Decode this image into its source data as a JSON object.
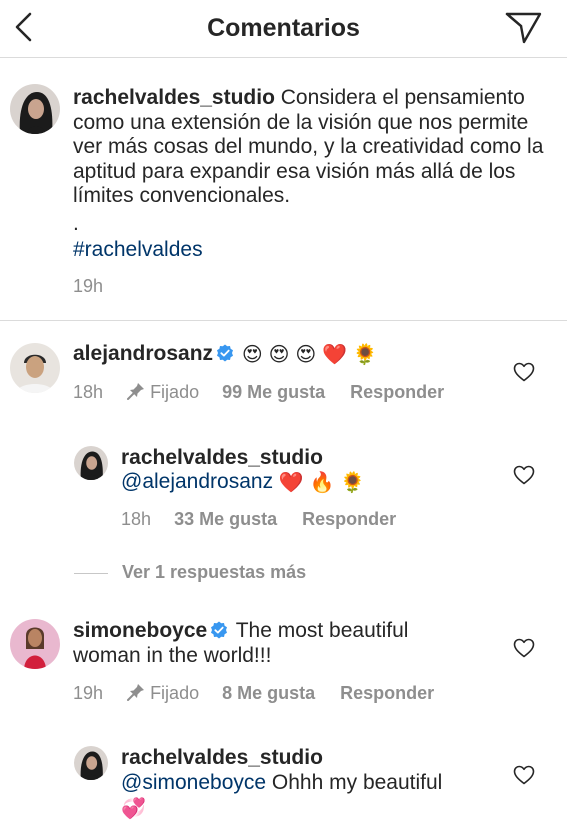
{
  "header": {
    "title": "Comentarios",
    "back_icon": "chevron-left-icon",
    "send_icon": "paper-plane-icon"
  },
  "caption": {
    "username": "rachelvaldes_studio",
    "text": "Considera el pensamiento como una extensión de la visión que nos permite ver más cosas del mundo, y la creatividad como la aptitud para expandir esa visión más allá de los límites convencionales.",
    "dot": ".",
    "hashtag": "#rachelvaldes",
    "time": "19h"
  },
  "comments": [
    {
      "username": "alejandrosanz",
      "verified": true,
      "emojis": [
        "😍",
        "😍",
        "😍",
        "❤️",
        "🌻"
      ],
      "time": "18h",
      "pinned_label": "Fijado",
      "likes": "99 Me gusta",
      "reply_label": "Responder",
      "reply": {
        "username": "rachelvaldes_studio",
        "mention": "@alejandrosanz",
        "emojis": [
          "❤️",
          "🔥",
          "🌻"
        ],
        "time": "18h",
        "likes": "33 Me gusta",
        "reply_label": "Responder"
      },
      "view_more": "Ver 1 respuestas más"
    },
    {
      "username": "simoneboyce",
      "verified": true,
      "text_line1": "The most beautiful",
      "text_line2": "woman in the world!!!",
      "time": "19h",
      "pinned_label": "Fijado",
      "likes": "8 Me gusta",
      "reply_label": "Responder",
      "reply": {
        "username": "rachelvaldes_studio",
        "mention": "@simoneboyce",
        "text": "Ohhh my beautiful",
        "emoji": "💞"
      }
    }
  ],
  "colors": {
    "text": "#262626",
    "secondary": "#8e8e8e",
    "link": "#003569",
    "verified": "#3897f0",
    "divider": "#dbdbdb"
  }
}
